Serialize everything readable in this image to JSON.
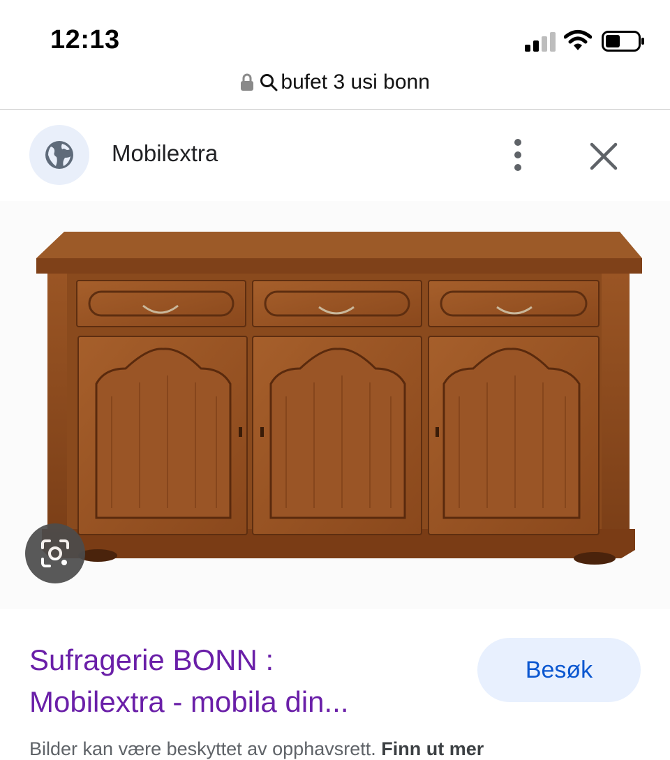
{
  "status_bar": {
    "time": "12:13",
    "icons": [
      "cellular-signal-icon",
      "wifi-icon",
      "battery-icon"
    ]
  },
  "url_bar": {
    "query": "bufet 3 usi bonn",
    "icons": [
      "lock-icon",
      "search-icon"
    ]
  },
  "source": {
    "site_name": "Mobilextra",
    "icons": [
      "globe-icon",
      "more-vert-icon",
      "close-icon"
    ]
  },
  "image": {
    "alt_subject": "wooden sideboard",
    "lens_icon": "google-lens-icon"
  },
  "result": {
    "title_line1": "Sufragerie BONN :",
    "title_line2": "Mobilextra - mobila din...",
    "visit_label": "Besøk",
    "copyright_text": "Bilder kan være beskyttet av opphavsrett.",
    "learn_more": "Finn ut mer"
  },
  "colors": {
    "title": "#6a1fa8",
    "button_bg": "#e8f0fe",
    "button_text": "#0b57d0",
    "wood": "#8b4a1e"
  }
}
